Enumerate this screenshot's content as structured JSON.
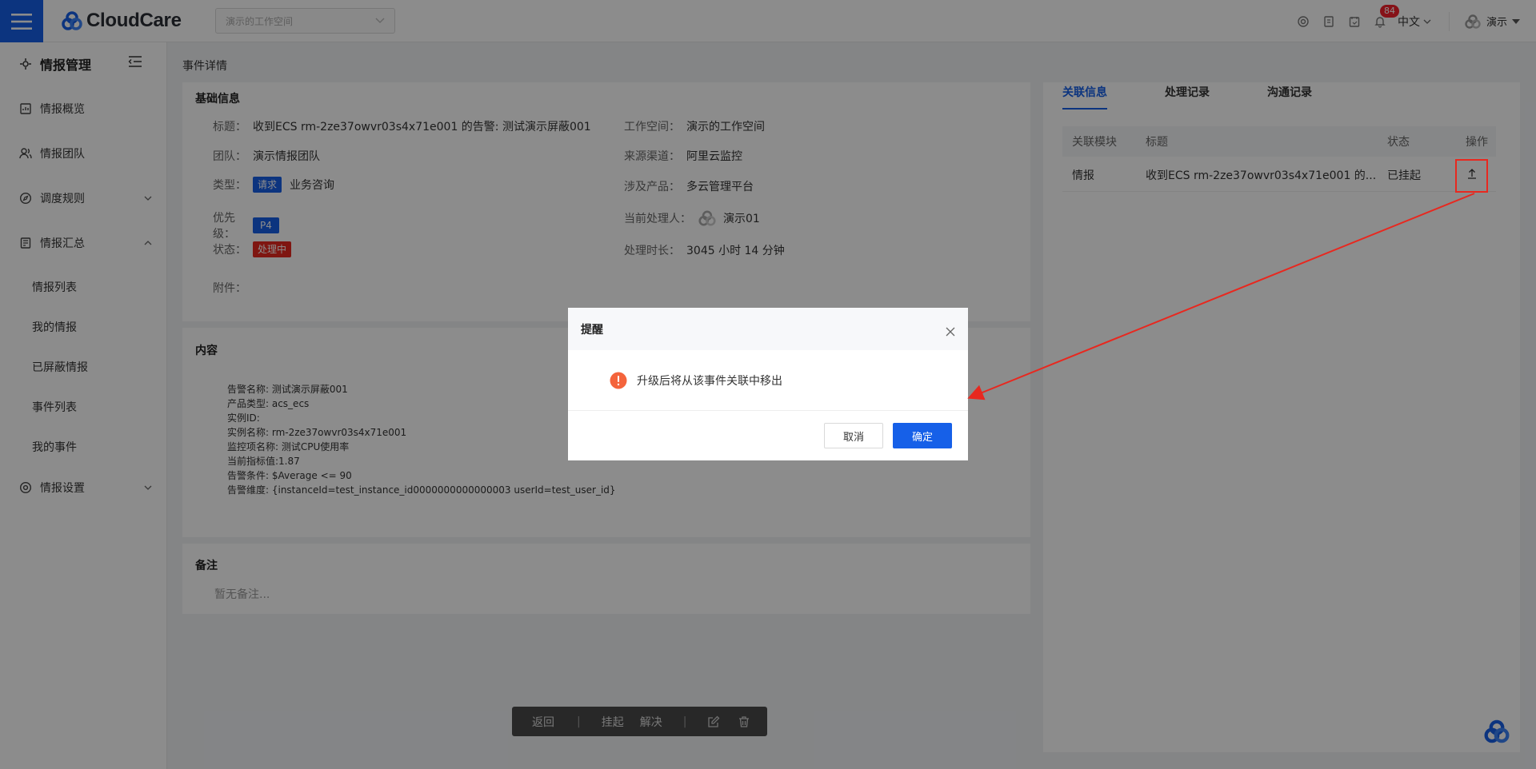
{
  "header": {
    "brand": "CloudCare",
    "workspace_placeholder": "演示的工作空间",
    "notification_count": "84",
    "language": "中文",
    "user": "演示"
  },
  "sidebar": {
    "title": "情报管理",
    "items": [
      {
        "label": "情报概览"
      },
      {
        "label": "情报团队"
      },
      {
        "label": "调度规则"
      },
      {
        "label": "情报汇总"
      },
      {
        "label": "情报设置"
      }
    ],
    "sub_items": [
      {
        "label": "情报列表"
      },
      {
        "label": "我的情报"
      },
      {
        "label": "已屏蔽情报"
      },
      {
        "label": "事件列表"
      },
      {
        "label": "我的事件"
      }
    ]
  },
  "page": {
    "breadcrumb": "事件详情"
  },
  "basic": {
    "title": "基础信息",
    "title_label": "标题：",
    "title_value": "收到ECS rm-2ze37owvr03s4x71e001 的告警: 测试演示屏蔽001",
    "team_label": "团队：",
    "team_value": "演示情报团队",
    "type_label": "类型：",
    "type_tag": "请求",
    "type_value": "业务咨询",
    "priority_label": "优先级：",
    "priority_tag": "P4",
    "status_label": "状态：",
    "status_tag": "处理中",
    "attachment_label": "附件：",
    "workspace_label": "工作空间：",
    "workspace_value": "演示的工作空间",
    "source_label": "来源渠道：",
    "source_value": "阿里云监控",
    "product_label": "涉及产品：",
    "product_value": "多云管理平台",
    "handler_label": "当前处理人：",
    "handler_value": "演示01",
    "duration_label": "处理时长：",
    "duration_value": "3045 小时 14 分钟"
  },
  "content": {
    "title": "内容",
    "lines": [
      "告警名称: 测试演示屏蔽001",
      "产品类型: acs_ecs",
      "实例ID:",
      "实例名称: rm-2ze37owvr03s4x71e001",
      "监控项名称: 测试CPU使用率",
      "当前指标值:1.87",
      "告警条件: $Average <= 90",
      "告警维度: {instanceId=test_instance_id0000000000000003 userId=test_user_id}"
    ]
  },
  "notes": {
    "title": "备注",
    "placeholder": "暂无备注..."
  },
  "right_panel": {
    "tabs": [
      "关联信息",
      "处理记录",
      "沟通记录"
    ],
    "columns": [
      "关联模块",
      "标题",
      "状态",
      "操作"
    ],
    "rows": [
      {
        "module": "情报",
        "title": "收到ECS rm-2ze37owvr03s4x71e001 的...",
        "status": "已挂起"
      }
    ]
  },
  "toolbar": {
    "back": "返回",
    "suspend": "挂起",
    "resolve": "解决"
  },
  "modal": {
    "title": "提醒",
    "message": "升级后将从该事件关联中移出",
    "cancel": "取消",
    "confirm": "确定"
  },
  "colors": {
    "primary": "#1660e8",
    "danger": "#e8281f",
    "warning": "#f4643c"
  }
}
